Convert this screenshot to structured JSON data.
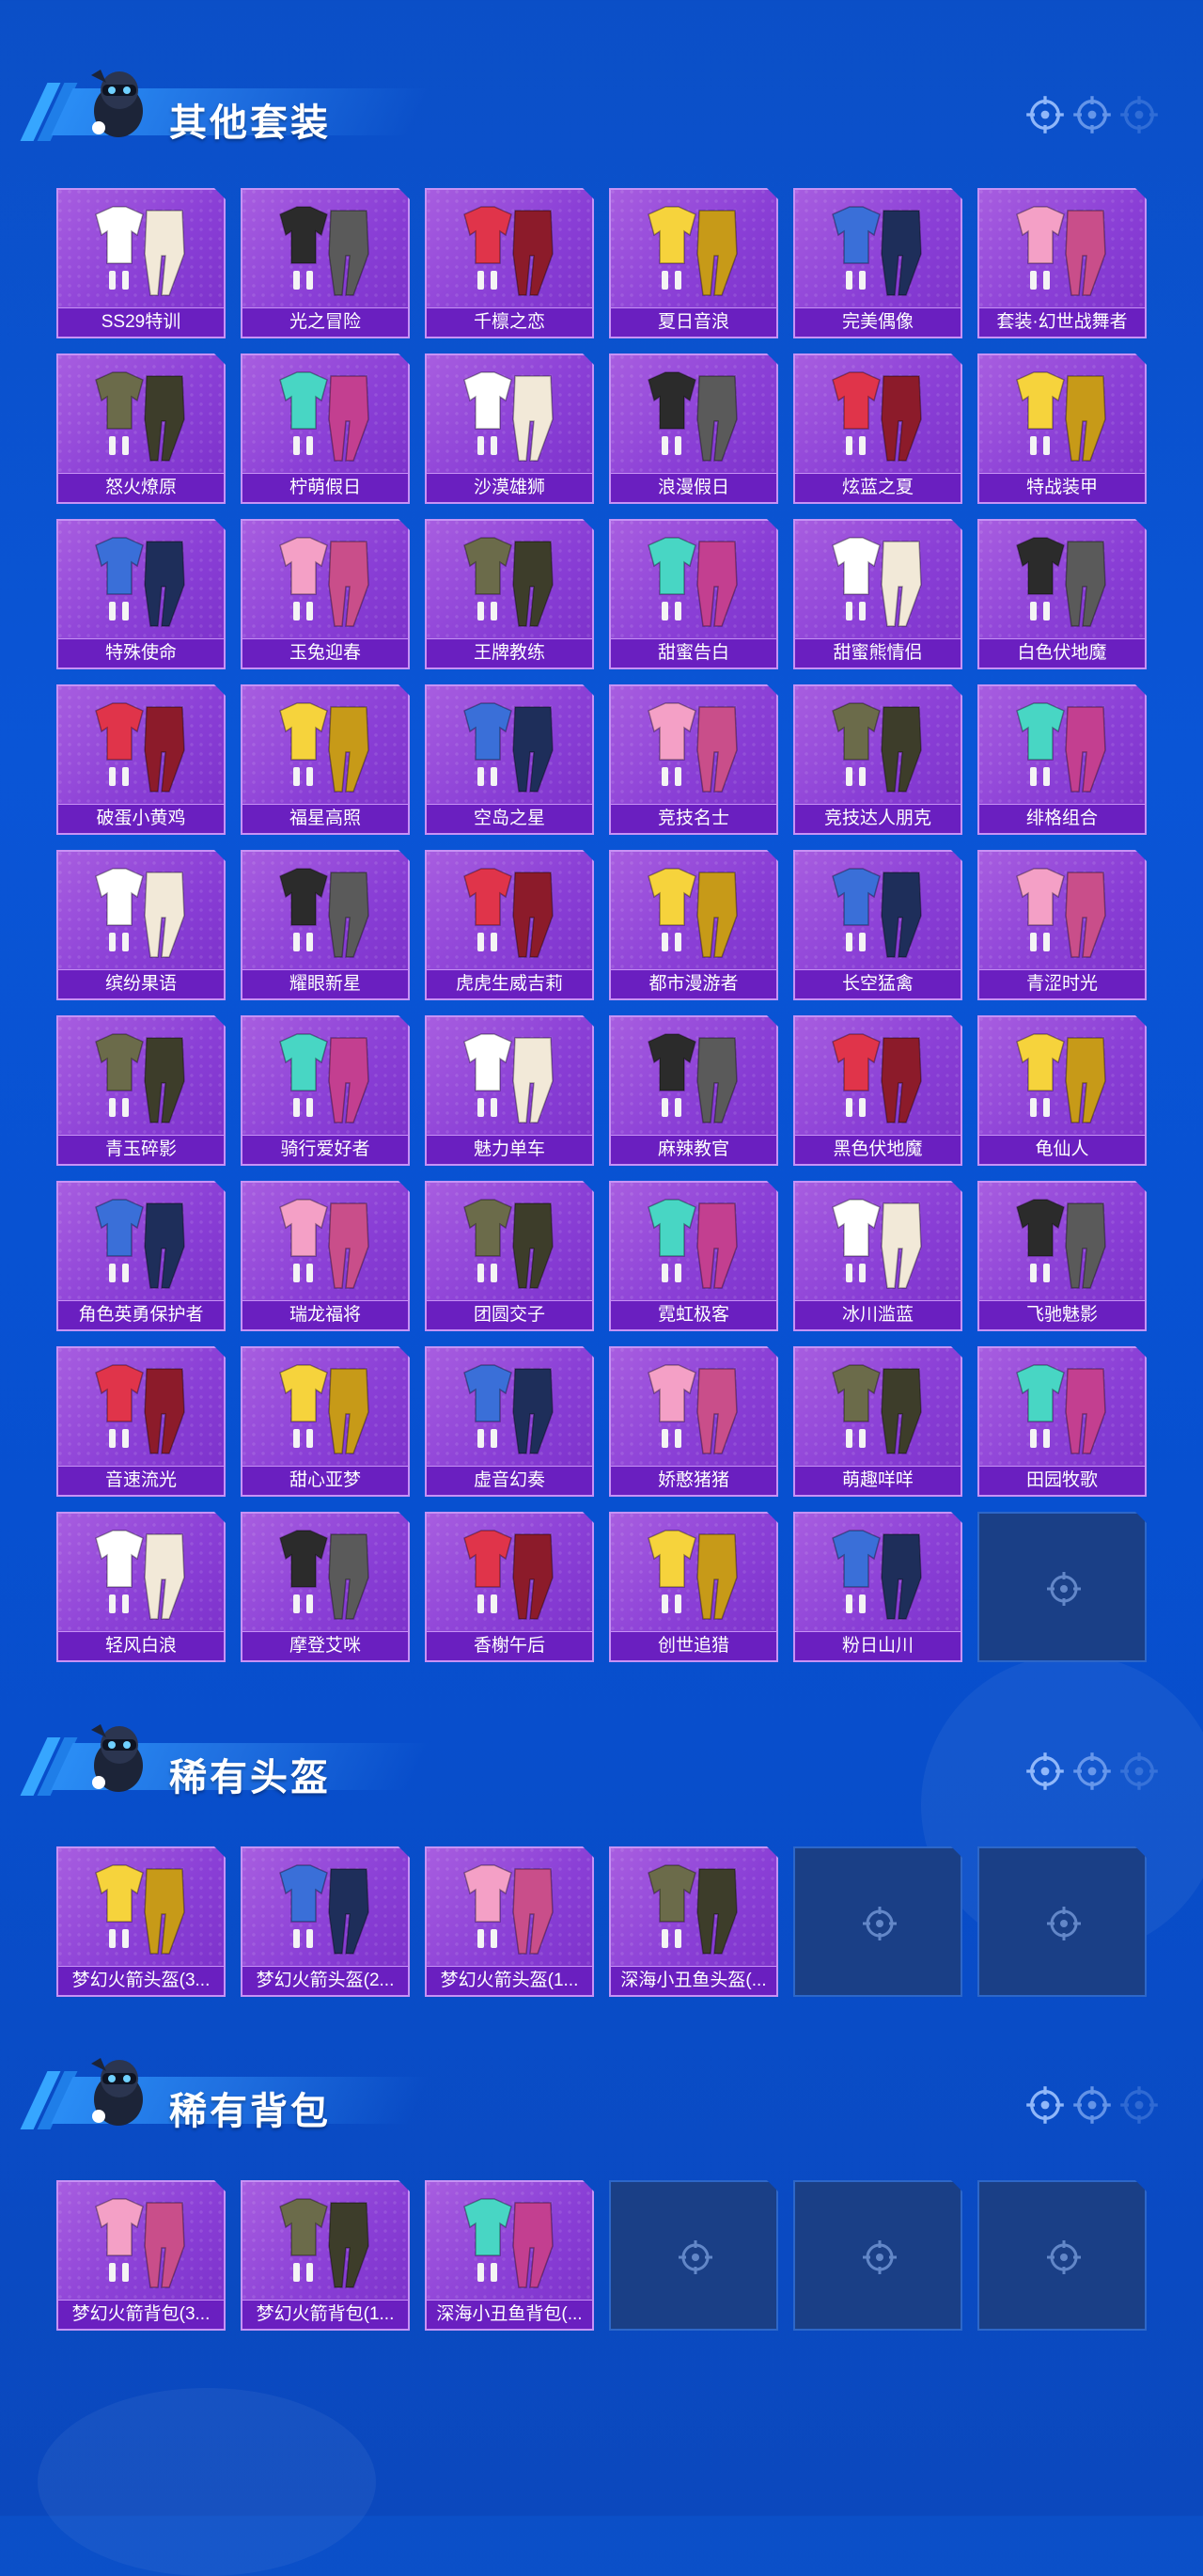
{
  "sections": [
    {
      "title": "其他套装",
      "items": [
        "SS29特训",
        "光之冒险",
        "千檩之恋",
        "夏日音浪",
        "完美偶像",
        "套装·幻世战舞者",
        "怒火燎原",
        "柠萌假日",
        "沙漠雄狮",
        "浪漫假日",
        "炫蓝之夏",
        "特战装甲",
        "特殊使命",
        "玉兔迎春",
        "王牌教练",
        "甜蜜告白",
        "甜蜜熊情侣",
        "白色伏地魔",
        "破蛋小黄鸡",
        "福星高照",
        "空岛之星",
        "竞技名士",
        "竞技达人朋克",
        "绯格组合",
        "缤纷果语",
        "耀眼新星",
        "虎虎生威吉莉",
        "都市漫游者",
        "长空猛禽",
        "青涩时光",
        "青玉碎影",
        "骑行爱好者",
        "魅力单车",
        "麻辣教官",
        "黑色伏地魔",
        "龟仙人",
        "角色英勇保护者",
        "瑞龙福将",
        "团圆交子",
        "霓虹极客",
        "冰川滥蓝",
        "飞驰魅影",
        "音速流光",
        "甜心亚梦",
        "虚音幻奏",
        "娇憨猪猪",
        "萌趣咩咩",
        "田园牧歌",
        "轻风白浪",
        "摩登艾咪",
        "香榭午后",
        "创世追猎",
        "粉日山川"
      ],
      "empty_slots": 1
    },
    {
      "title": "稀有头盔",
      "items": [
        "梦幻火箭头盔(3...",
        "梦幻火箭头盔(2...",
        "梦幻火箭头盔(1...",
        "深海小丑鱼头盔(..."
      ],
      "empty_slots": 2
    },
    {
      "title": "稀有背包",
      "items": [
        "梦幻火箭背包(3...",
        "梦幻火箭背包(1...",
        "深海小丑鱼背包(..."
      ],
      "empty_slots": 3
    }
  ],
  "icons": {
    "slot": "crosshair-icon",
    "mascot": "mascot-icon"
  },
  "colors": {
    "card": "#8a3fd6",
    "label": "#6a1fc0",
    "empty": "#1a3f86",
    "background": "#0b4fc7"
  }
}
